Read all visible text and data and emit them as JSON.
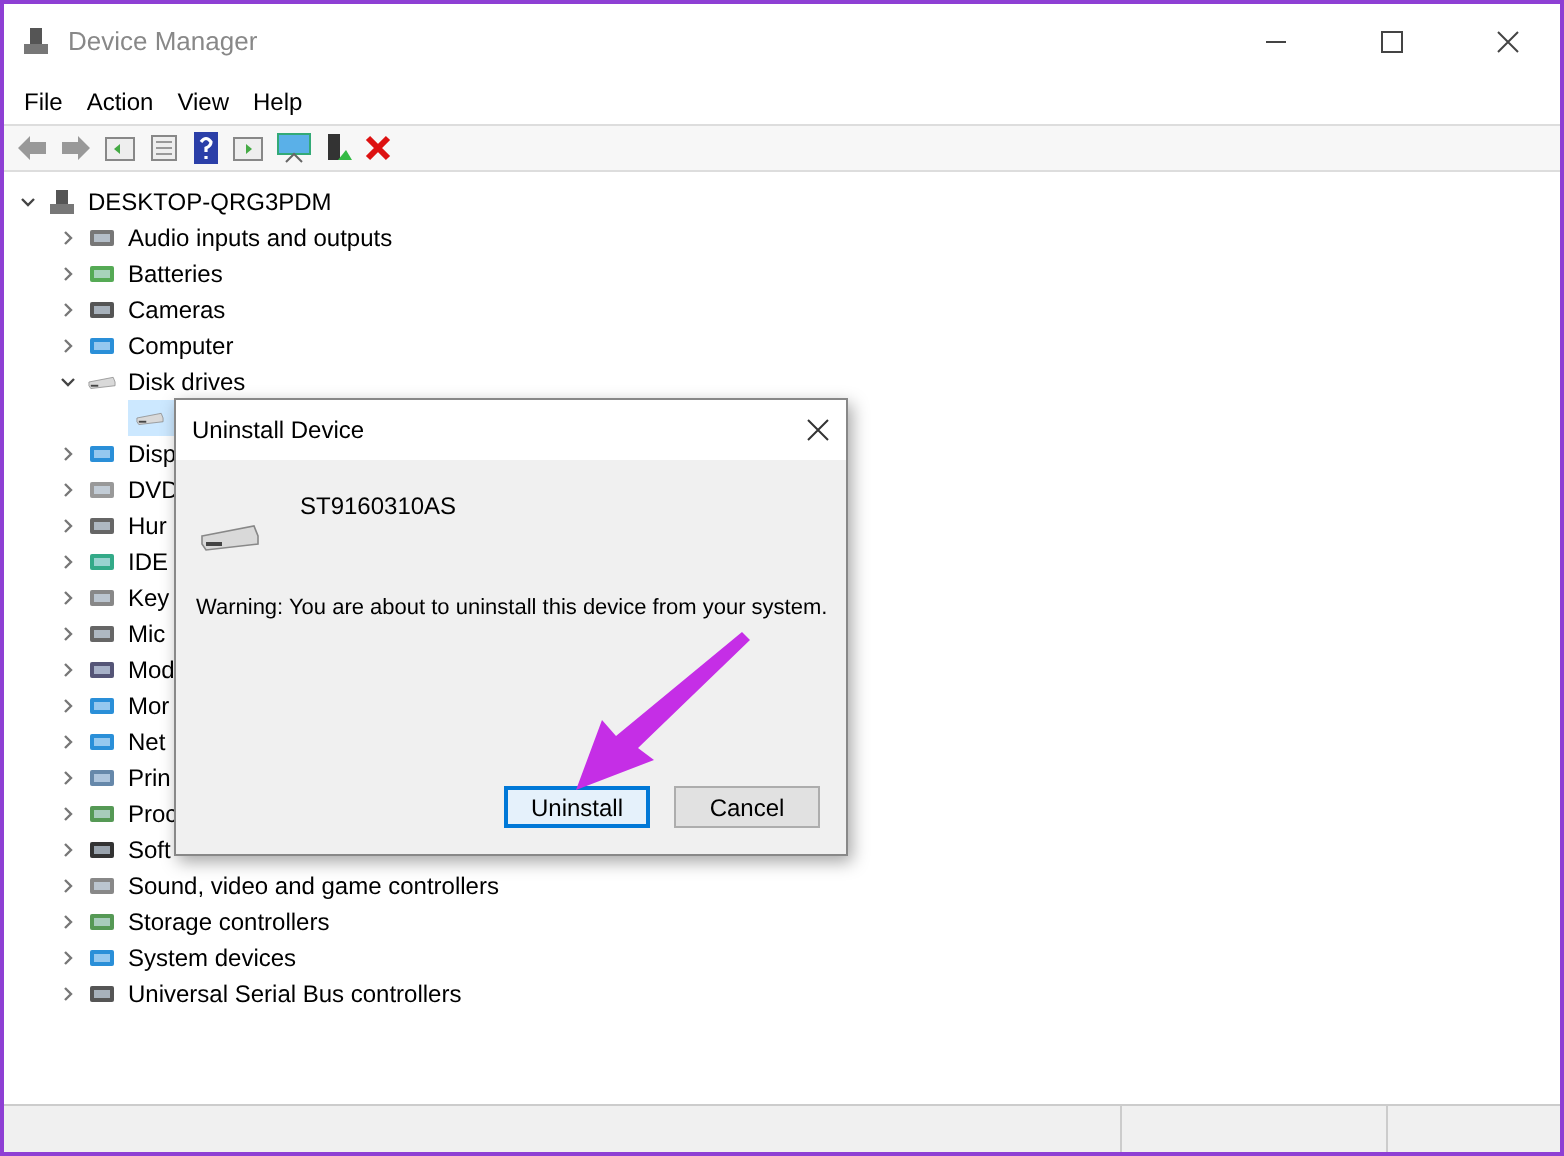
{
  "window": {
    "title": "Device Manager"
  },
  "menu": [
    "File",
    "Action",
    "View",
    "Help"
  ],
  "tree": {
    "label": "DESKTOP-QRG3PDM",
    "expanded": true,
    "children": [
      {
        "label": "Audio inputs and outputs",
        "expanded": false
      },
      {
        "label": "Batteries",
        "expanded": false
      },
      {
        "label": "Cameras",
        "expanded": false
      },
      {
        "label": "Computer",
        "expanded": false
      },
      {
        "label": "Disk drives",
        "expanded": true,
        "children": [
          {
            "selected": true
          }
        ]
      },
      {
        "label": "Disp",
        "expanded": false
      },
      {
        "label": "DVD",
        "expanded": false
      },
      {
        "label": "Hur",
        "expanded": false
      },
      {
        "label": "IDE",
        "expanded": false
      },
      {
        "label": "Key",
        "expanded": false
      },
      {
        "label": "Mic",
        "expanded": false
      },
      {
        "label": "Mod",
        "expanded": false
      },
      {
        "label": "Mor",
        "expanded": false
      },
      {
        "label": "Net",
        "expanded": false
      },
      {
        "label": "Prin",
        "expanded": false
      },
      {
        "label": "Proc",
        "expanded": false
      },
      {
        "label": "Soft",
        "expanded": false
      },
      {
        "label": "Sound, video and game controllers",
        "expanded": false
      },
      {
        "label": "Storage controllers",
        "expanded": false
      },
      {
        "label": "System devices",
        "expanded": false
      },
      {
        "label": "Universal Serial Bus controllers",
        "expanded": false
      }
    ]
  },
  "dialog": {
    "title": "Uninstall Device",
    "device": "ST9160310AS",
    "warning": "Warning: You are about to uninstall this device from your system.",
    "buttons": [
      {
        "label": "Uninstall",
        "selected": true
      },
      {
        "label": "Cancel",
        "selected": false
      }
    ]
  }
}
